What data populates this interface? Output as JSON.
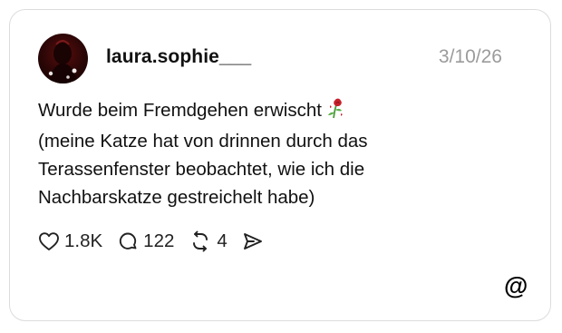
{
  "post": {
    "username": "laura.sophie___",
    "date": "3/10/26",
    "text_lines": [
      "Wurde beim Fremdgehen erwischt",
      "(meine Katze hat von drinnen durch das",
      "Terassenfenster beobachtet, wie ich die",
      "Nachbarskatze gestreichelt habe)"
    ],
    "emoji": "wilted-rose"
  },
  "actions": {
    "likes": "1.8K",
    "comments": "122",
    "reposts": "4",
    "like_icon": "heart-icon",
    "comment_icon": "speech-bubble-icon",
    "repost_icon": "repost-icon",
    "share_icon": "send-icon"
  },
  "brand": {
    "logo": "threads-logo"
  },
  "colors": {
    "text": "#111111",
    "muted": "#9b9b9b",
    "border": "#dcdcdc",
    "background": "#ffffff"
  }
}
